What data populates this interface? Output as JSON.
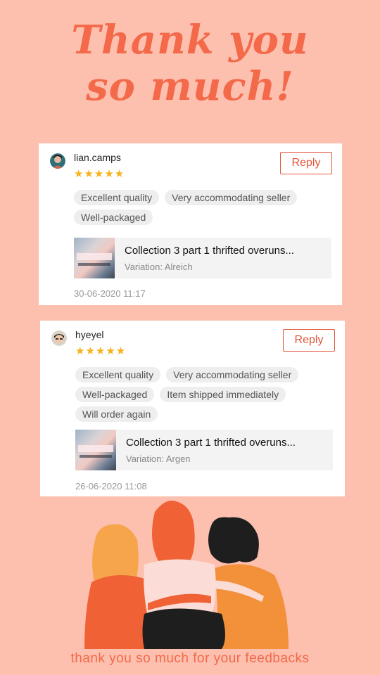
{
  "headline": {
    "line1": "Thank you",
    "line2": "so much!"
  },
  "reviews": [
    {
      "username": "lian.camps",
      "stars": "★★★★★",
      "rating": 5,
      "reply_label": "Reply",
      "tags": [
        "Excellent quality",
        "Very accommodating seller",
        "Well-packaged"
      ],
      "product_title": "Collection 3 part 1 thrifted overuns...",
      "variation": "Variation: Alreich",
      "date": "30-06-2020 11:17"
    },
    {
      "username": "hyeyel",
      "stars": "★★★★★",
      "rating": 5,
      "reply_label": "Reply",
      "tags": [
        "Excellent quality",
        "Very accommodating seller",
        "Well-packaged",
        "Item shipped immediately",
        "Will order again"
      ],
      "product_title": "Collection 3 part 1 thrifted overuns...",
      "variation": "Variation: Argen",
      "date": "26-06-2020 11:08"
    }
  ],
  "footer": "thank you so much for your feedbacks",
  "colors": {
    "background": "#fdbfae",
    "accent": "#f3694a",
    "star": "#f6b21a",
    "reply_border": "#e2553a"
  },
  "icons": {
    "avatar1": "avatar-icon",
    "avatar2": "avatar-icon"
  }
}
